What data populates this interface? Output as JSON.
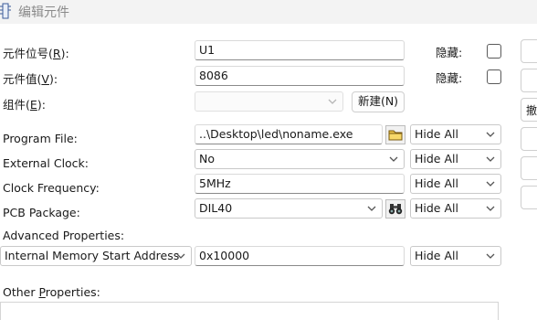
{
  "window": {
    "title": "编辑元件"
  },
  "fields": {
    "ref_label": "元件位号",
    "ref_mnemonic": "R",
    "ref_value": "U1",
    "val_label": "元件值",
    "val_mnemonic": "V",
    "val_value": "8086",
    "group_label": "组件",
    "group_mnemonic": "E",
    "group_value": "",
    "new_button": "新建(N)",
    "hidden_label": "隐藏:",
    "hidden_ref_checked": false,
    "hidden_val_checked": false
  },
  "properties": [
    {
      "label": "Program File:",
      "mnemonic": "",
      "value": "..\\Desktop\\led\\noname.exe",
      "visibility": "Hide All"
    },
    {
      "label": "External Clock:",
      "mnemonic": "",
      "value": "No",
      "visibility": "Hide All"
    },
    {
      "label": "Clock Frequency:",
      "mnemonic": "",
      "value": "5MHz",
      "visibility": "Hide All"
    },
    {
      "label": "PCB Package:",
      "mnemonic": "",
      "value": "DIL40",
      "visibility": "Hide All"
    }
  ],
  "advanced": {
    "label": "Advanced Properties:",
    "property": "Internal Memory Start Address",
    "value": "0x10000",
    "visibility": "Hide All"
  },
  "other": {
    "label_pre": "Other ",
    "label_mnemonic": "P",
    "label_post": "roperties:"
  },
  "side_buttons": [
    "",
    "",
    "撤",
    "",
    "",
    ""
  ],
  "icons": {
    "title": "component-icon",
    "browse": "folder-icon",
    "package": "binoculars-icon",
    "dropdown": "chevron-down-icon"
  }
}
